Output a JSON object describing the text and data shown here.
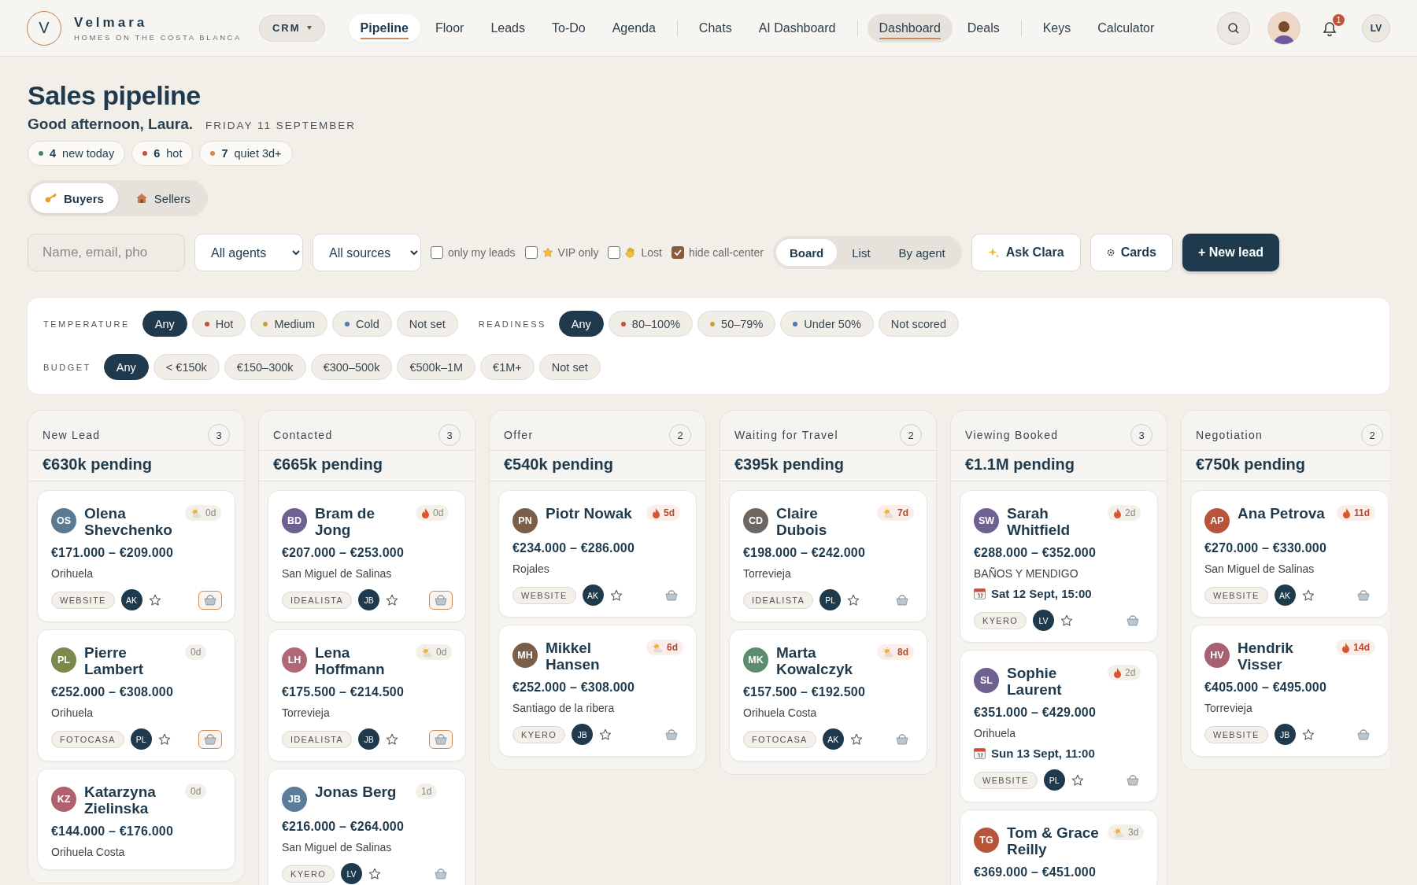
{
  "brand": {
    "initial": "V",
    "name": "Velmara",
    "tagline": "HOMES ON THE COSTA BLANCA"
  },
  "module_switch": {
    "label": "CRM",
    "expanded": false
  },
  "nav_groups": [
    [
      {
        "label": "Pipeline",
        "selected": true,
        "highlighted": false
      },
      {
        "label": "Floor",
        "selected": false,
        "highlighted": false
      },
      {
        "label": "Leads",
        "selected": false,
        "highlighted": false
      },
      {
        "label": "To-Do",
        "selected": false,
        "highlighted": false
      },
      {
        "label": "Agenda",
        "selected": false,
        "highlighted": false
      }
    ],
    [
      {
        "label": "Chats",
        "selected": false,
        "highlighted": false
      },
      {
        "label": "AI Dashboard",
        "selected": false,
        "highlighted": false
      }
    ],
    [
      {
        "label": "Dashboard",
        "selected": false,
        "highlighted": true
      },
      {
        "label": "Deals",
        "selected": false,
        "highlighted": false
      }
    ],
    [
      {
        "label": "Keys",
        "selected": false,
        "highlighted": false
      },
      {
        "label": "Calculator",
        "selected": false,
        "highlighted": false
      }
    ]
  ],
  "notifications": {
    "count": "1"
  },
  "user": {
    "initials": "LV"
  },
  "header": {
    "title": "Sales pipeline",
    "greeting": "Good afternoon, Laura.",
    "date": "FRIDAY 11 SEPTEMBER"
  },
  "stats": [
    {
      "count": "4",
      "label": "new today",
      "color": "#3f8a5a"
    },
    {
      "count": "6",
      "label": "hot",
      "color": "#c0533a"
    },
    {
      "count": "7",
      "label": "quiet 3d+",
      "color": "#d08a4a"
    }
  ],
  "audience_tabs": [
    {
      "label": "Buyers",
      "kind": "key",
      "selected": true
    },
    {
      "label": "Sellers",
      "kind": "house",
      "selected": false
    }
  ],
  "toolbar": {
    "search": {
      "placeholder": "Name, email, pho"
    },
    "selects": [
      {
        "value": "All agents"
      },
      {
        "value": "All sources"
      }
    ],
    "toggles": [
      {
        "label": "only my leads",
        "checked": false
      },
      {
        "label": "VIP only",
        "kind": "star",
        "checked": false
      },
      {
        "label": "Lost",
        "kind": "hand",
        "checked": false
      },
      {
        "label": "hide call-center",
        "checked": true
      }
    ],
    "views": [
      {
        "label": "Board",
        "selected": true
      },
      {
        "label": "List",
        "selected": false
      },
      {
        "label": "By agent",
        "selected": false
      }
    ],
    "actions": [
      {
        "label": "Ask Clara",
        "kind": "ai"
      },
      {
        "label": "Cards",
        "kind": "settings"
      },
      {
        "label": "+ New lead",
        "kind": "primary"
      }
    ]
  },
  "filters": [
    [
      {
        "label": "TEMPERATURE",
        "options": [
          {
            "label": "Any",
            "selected": true
          },
          {
            "label": "Hot",
            "selected": false,
            "color": "#c0533a"
          },
          {
            "label": "Medium",
            "selected": false,
            "color": "#c9a040"
          },
          {
            "label": "Cold",
            "selected": false,
            "color": "#4a7ab0"
          },
          {
            "label": "Not set",
            "selected": false
          }
        ]
      },
      {
        "label": "READINESS",
        "options": [
          {
            "label": "Any",
            "selected": true
          },
          {
            "label": "80–100%",
            "selected": false,
            "color": "#c0533a"
          },
          {
            "label": "50–79%",
            "selected": false,
            "color": "#c9a040"
          },
          {
            "label": "Under 50%",
            "selected": false,
            "color": "#4a7ab0"
          },
          {
            "label": "Not scored",
            "selected": false
          }
        ]
      }
    ],
    [
      {
        "label": "BUDGET",
        "options": [
          {
            "label": "Any",
            "selected": true
          },
          {
            "label": "< €150k",
            "selected": false
          },
          {
            "label": "€150–300k",
            "selected": false
          },
          {
            "label": "€300–500k",
            "selected": false
          },
          {
            "label": "€500k–1M",
            "selected": false
          },
          {
            "label": "€1M+",
            "selected": false
          },
          {
            "label": "Not set",
            "selected": false
          }
        ]
      }
    ]
  ],
  "columns": [
    {
      "title": "New Lead",
      "count": "3",
      "pending": "€630k pending",
      "cards": [
        {
          "initials": "OS",
          "color": "#5a7a94",
          "name": "Olena Shevchenko",
          "price": "€171.000 – €209.000",
          "location": "Orihuela",
          "source": "WEBSITE",
          "agent": "AK",
          "kind": "warm",
          "age": "0d",
          "overdue": false,
          "basket_active": true
        },
        {
          "initials": "PL",
          "color": "#7a8a4a",
          "name": "Pierre Lambert",
          "price": "€252.000 – €308.000",
          "location": "Orihuela",
          "source": "FOTOCASA",
          "agent": "PL",
          "age": "0d",
          "overdue": false,
          "basket_active": true
        },
        {
          "initials": "KZ",
          "color": "#b0606e",
          "name": "Katarzyna Zielinska",
          "price": "€144.000 – €176.000",
          "location": "Orihuela Costa",
          "age": "0d",
          "overdue": false
        }
      ]
    },
    {
      "title": "Contacted",
      "count": "3",
      "pending": "€665k pending",
      "cards": [
        {
          "initials": "BD",
          "color": "#6e6090",
          "name": "Bram de Jong",
          "price": "€207.000 – €253.000",
          "location": "San Miguel de Salinas",
          "source": "IDEALISTA",
          "agent": "JB",
          "kind": "hot",
          "age": "0d",
          "overdue": false,
          "basket_active": true
        },
        {
          "initials": "LH",
          "color": "#b06878",
          "name": "Lena Hoffmann",
          "price": "€175.500 – €214.500",
          "location": "Torrevieja",
          "source": "IDEALISTA",
          "agent": "JB",
          "kind": "warm",
          "age": "0d",
          "overdue": false,
          "basket_active": true
        },
        {
          "initials": "JB",
          "color": "#5c7c9c",
          "name": "Jonas Berg",
          "price": "€216.000 – €264.000",
          "location": "San Miguel de Salinas",
          "source": "KYERO",
          "agent": "LV",
          "age": "1d",
          "overdue": false,
          "basket_active": false
        }
      ]
    },
    {
      "title": "Offer",
      "count": "2",
      "pending": "€540k pending",
      "cards": [
        {
          "initials": "PN",
          "color": "#7a5e4a",
          "name": "Piotr Nowak",
          "price": "€234.000 – €286.000",
          "location": "Rojales",
          "source": "WEBSITE",
          "agent": "AK",
          "kind": "hot",
          "age": "5d",
          "overdue": true,
          "basket_active": false
        },
        {
          "initials": "MH",
          "color": "#7a5e4a",
          "name": "Mikkel Hansen",
          "price": "€252.000 – €308.000",
          "location": "Santiago de la ribera",
          "source": "KYERO",
          "agent": "JB",
          "kind": "warm",
          "age": "6d",
          "overdue": true,
          "basket_active": false
        }
      ]
    },
    {
      "title": "Waiting for Travel",
      "count": "2",
      "pending": "€395k pending",
      "cards": [
        {
          "initials": "CD",
          "color": "#6e6660",
          "name": "Claire Dubois",
          "price": "€198.000 – €242.000",
          "location": "Torrevieja",
          "source": "IDEALISTA",
          "agent": "PL",
          "kind": "warm",
          "age": "7d",
          "overdue": true,
          "basket_active": false
        },
        {
          "initials": "MK",
          "color": "#5e8c6e",
          "name": "Marta Kowalczyk",
          "price": "€157.500 – €192.500",
          "location": "Orihuela Costa",
          "source": "FOTOCASA",
          "agent": "AK",
          "kind": "warm",
          "age": "8d",
          "overdue": true,
          "basket_active": false
        }
      ]
    },
    {
      "title": "Viewing Booked",
      "count": "3",
      "pending": "€1.1M pending",
      "cards": [
        {
          "initials": "SW",
          "color": "#6e6090",
          "name": "Sarah Whitfield",
          "price": "€288.000 – €352.000",
          "location": "BAÑOS Y MENDIGO",
          "appointment": "Sat 12 Sept, 15:00",
          "source": "KYERO",
          "agent": "LV",
          "kind": "hot",
          "age": "2d",
          "overdue": false,
          "basket_active": false
        },
        {
          "initials": "SL",
          "color": "#6e6090",
          "name": "Sophie Laurent",
          "price": "€351.000 – €429.000",
          "location": "Orihuela",
          "appointment": "Sun 13 Sept, 11:00",
          "source": "WEBSITE",
          "agent": "PL",
          "kind": "hot",
          "age": "2d",
          "overdue": false,
          "basket_active": false
        },
        {
          "initials": "TG",
          "color": "#b8543a",
          "name": "Tom & Grace Reilly",
          "price": "€369.000 – €451.000",
          "kind": "warm",
          "age": "3d",
          "overdue": false
        }
      ]
    },
    {
      "title": "Negotiation",
      "count": "2",
      "pending": "€750k pending",
      "cards": [
        {
          "initials": "AP",
          "color": "#b8543a",
          "name": "Ana Petrova",
          "price": "€270.000 – €330.000",
          "location": "San Miguel de Salinas",
          "source": "WEBSITE",
          "agent": "AK",
          "kind": "hot",
          "age": "11d",
          "overdue": true,
          "basket_active": false
        },
        {
          "initials": "HV",
          "color": "#a86070",
          "name": "Hendrik Visser",
          "price": "€405.000 – €495.000",
          "location": "Torrevieja",
          "source": "WEBSITE",
          "agent": "JB",
          "kind": "hot",
          "age": "14d",
          "overdue": true,
          "basket_active": false
        }
      ]
    }
  ]
}
